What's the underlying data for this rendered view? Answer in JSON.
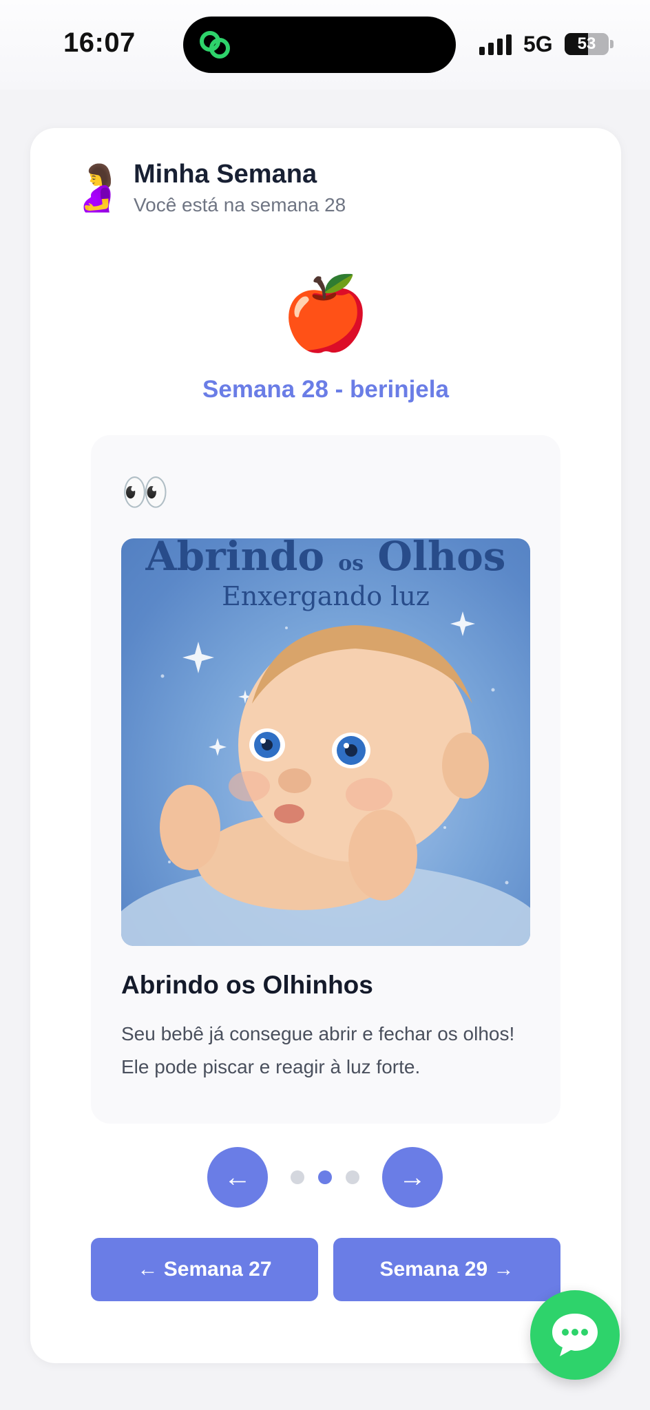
{
  "status_bar": {
    "time": "16:07",
    "network": "5G",
    "battery": "53",
    "battery_level": 0.53
  },
  "header": {
    "emoji": "🤰",
    "title": "Minha Semana",
    "subtitle": "Você está na semana 28"
  },
  "week": {
    "fruit_emoji": "🍎",
    "title": "Semana 28 - berinjela"
  },
  "card": {
    "emoji": "👀",
    "image": {
      "title_main_left": "Abrindo",
      "title_small": "os",
      "title_main_right": "Olhos",
      "subtitle": "Enxergando luz"
    },
    "heading": "Abrindo os Olhinhos",
    "text": "Seu bebê já consegue abrir e fechar os olhos! Ele pode piscar e reagir à luz forte."
  },
  "carousel": {
    "prev_icon": "arrow-left-icon",
    "next_icon": "arrow-right-icon",
    "prev_glyph": "←",
    "next_glyph": "→",
    "active_index": 1,
    "total": 3
  },
  "navigation": {
    "prev_week_label": "← Semana 27",
    "next_week_label": "Semana 29 →"
  },
  "colors": {
    "accent": "#6a7de6",
    "chat": "#2ed36b",
    "background": "#f3f3f6"
  },
  "chat": {
    "icon": "chat-bubble-icon"
  }
}
